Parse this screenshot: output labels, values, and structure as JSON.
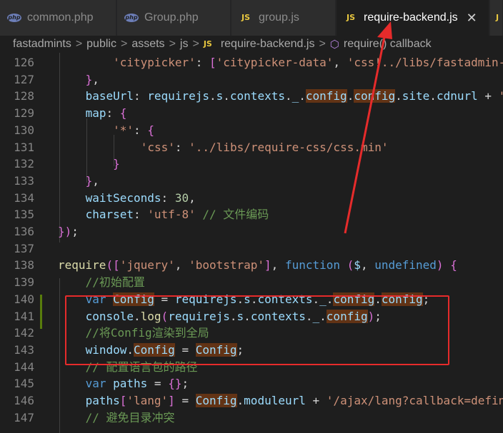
{
  "tabs": [
    {
      "label": "common.php",
      "icon": "php-icon"
    },
    {
      "label": "Group.php",
      "icon": "php-icon"
    },
    {
      "label": "group.js",
      "icon": "js-icon"
    },
    {
      "label": "require-backend.js",
      "icon": "js-icon",
      "close": "✕"
    }
  ],
  "breadcrumb": {
    "items": [
      "fastadmints",
      "public",
      "assets",
      "js"
    ],
    "file": "require-backend.js",
    "symbol": "require() callback",
    "separator": ">"
  },
  "lines": [
    {
      "no": "126",
      "text": "    'citypicker': ['citypicker-data', 'css!../libs/fastadmin-"
    },
    {
      "no": "127",
      "text": "  },"
    },
    {
      "no": "128",
      "text": "  baseUrl: requirejs.s.contexts._.config.config.site.cdnurl + '"
    },
    {
      "no": "129",
      "text": "  map: {"
    },
    {
      "no": "130",
      "text": "    '*': {"
    },
    {
      "no": "131",
      "text": "      'css': '../libs/require-css/css.min'"
    },
    {
      "no": "132",
      "text": "    }"
    },
    {
      "no": "133",
      "text": "  },"
    },
    {
      "no": "134",
      "text": "  waitSeconds: 30,"
    },
    {
      "no": "135",
      "text": "  charset: 'utf-8' // 文件编码"
    },
    {
      "no": "136",
      "text": "});"
    },
    {
      "no": "137",
      "text": ""
    },
    {
      "no": "138",
      "text": "require(['jquery', 'bootstrap'], function ($, undefined) {"
    },
    {
      "no": "139",
      "text": "  //初始配置"
    },
    {
      "no": "140",
      "text": "  var Config = requirejs.s.contexts._.config.config;"
    },
    {
      "no": "141",
      "text": "  console.log(requirejs.s.contexts._.config);"
    },
    {
      "no": "142",
      "text": "  //将Config渲染到全局"
    },
    {
      "no": "143",
      "text": "  window.Config = Config;"
    },
    {
      "no": "144",
      "text": "  // 配置语言包的路径"
    },
    {
      "no": "145",
      "text": "  var paths = {};"
    },
    {
      "no": "146",
      "text": "  paths['lang'] = Config.moduleurl + '/ajax/lang?callback=defin"
    },
    {
      "no": "147",
      "text": "  // 避免目录冲突"
    }
  ],
  "colors": {
    "editor_bg": "#1e1e1e",
    "annotation_red": "#e62b2b",
    "keyword": "#569cd6",
    "string": "#ce9178",
    "comment": "#6a9955"
  }
}
